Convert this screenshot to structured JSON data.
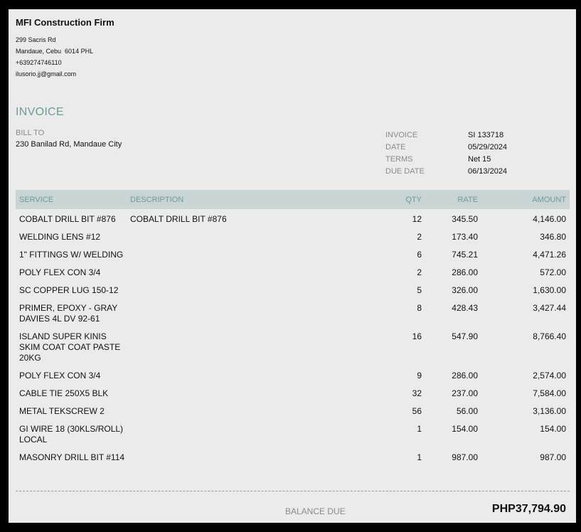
{
  "company": {
    "name": "MFI Construction Firm",
    "address_line1": "299 Sacris Rd",
    "address_line2": "Mandaue, Cebu  6014 PHL",
    "phone": "+639274746110",
    "email": "ilusorio.jj@gmail.com"
  },
  "invoice_title": "INVOICE",
  "bill_to": {
    "label": "BILL TO",
    "address": "230 Banilad Rd, Mandaue City"
  },
  "meta": [
    {
      "label": "INVOICE",
      "value": "SI 133718"
    },
    {
      "label": "DATE",
      "value": "05/29/2024"
    },
    {
      "label": "TERMS",
      "value": "Net 15"
    },
    {
      "label": "DUE DATE",
      "value": "06/13/2024"
    }
  ],
  "table": {
    "headers": {
      "service": "SERVICE",
      "description": "DESCRIPTION",
      "qty": "QTY",
      "rate": "RATE",
      "amount": "AMOUNT"
    },
    "rows": [
      {
        "service": "COBALT DRILL BIT #876",
        "description": "COBALT DRILL BIT #876",
        "qty": "12",
        "rate": "345.50",
        "amount": "4,146.00"
      },
      {
        "service": "WELDING LENS #12",
        "description": "",
        "qty": "2",
        "rate": "173.40",
        "amount": "346.80"
      },
      {
        "service": "1\" FITTINGS W/ WELDING",
        "description": "",
        "qty": "6",
        "rate": "745.21",
        "amount": "4,471.26"
      },
      {
        "service": "POLY FLEX CON 3/4",
        "description": "",
        "qty": "2",
        "rate": "286.00",
        "amount": "572.00"
      },
      {
        "service": "SC COPPER LUG 150-12",
        "description": "",
        "qty": "5",
        "rate": "326.00",
        "amount": "1,630.00"
      },
      {
        "service": "PRIMER, EPOXY - GRAY DAVIES 4L DV 92-61",
        "description": "",
        "qty": "8",
        "rate": "428.43",
        "amount": "3,427.44"
      },
      {
        "service": "ISLAND SUPER KINIS SKIM COAT COAT PASTE 20KG",
        "description": "",
        "qty": "16",
        "rate": "547.90",
        "amount": "8,766.40"
      },
      {
        "service": "POLY FLEX CON 3/4",
        "description": "",
        "qty": "9",
        "rate": "286.00",
        "amount": "2,574.00"
      },
      {
        "service": "CABLE TIE 250X5 BLK",
        "description": "",
        "qty": "32",
        "rate": "237.00",
        "amount": "7,584.00"
      },
      {
        "service": "METAL TEKSCREW 2",
        "description": "",
        "qty": "56",
        "rate": "56.00",
        "amount": "3,136.00"
      },
      {
        "service": "GI WIRE 18 (30KLS/ROLL) LOCAL",
        "description": "",
        "qty": "1",
        "rate": "154.00",
        "amount": "154.00"
      },
      {
        "service": "MASONRY DRILL BIT #114",
        "description": "",
        "qty": "1",
        "rate": "987.00",
        "amount": "987.00"
      }
    ]
  },
  "balance": {
    "label": "BALANCE DUE",
    "value": "PHP37,794.90"
  }
}
